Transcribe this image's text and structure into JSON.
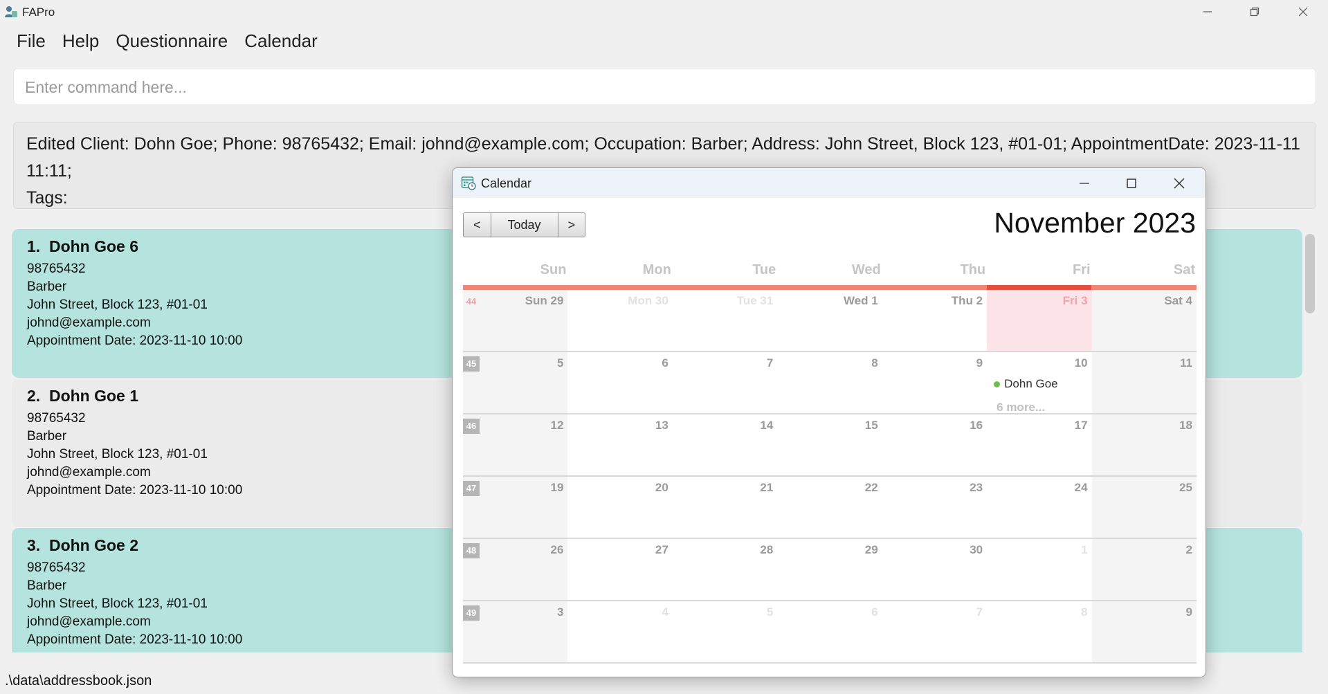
{
  "app": {
    "title": "FAPro"
  },
  "menu": [
    "File",
    "Help",
    "Questionnaire",
    "Calendar"
  ],
  "command": {
    "placeholder": "Enter command here..."
  },
  "result": {
    "line1": "Edited Client: Dohn Goe; Phone: 98765432; Email: johnd@example.com; Occupation: Barber; Address: John Street, Block 123, #01-01; AppointmentDate: 2023-11-11 11:11;",
    "line2": "Tags:"
  },
  "clients": [
    {
      "index": "1.",
      "name": "Dohn Goe 6",
      "phone": "98765432",
      "occupation": "Barber",
      "address": "John Street, Block 123, #01-01",
      "email": "johnd@example.com",
      "appointment": "Appointment Date: 2023-11-10 10:00"
    },
    {
      "index": "2.",
      "name": "Dohn Goe 1",
      "phone": "98765432",
      "occupation": "Barber",
      "address": "John Street, Block 123, #01-01",
      "email": "johnd@example.com",
      "appointment": "Appointment Date: 2023-11-10 10:00"
    },
    {
      "index": "3.",
      "name": "Dohn Goe 2",
      "phone": "98765432",
      "occupation": "Barber",
      "address": "John Street, Block 123, #01-01",
      "email": "johnd@example.com",
      "appointment": "Appointment Date: 2023-11-10 10:00"
    }
  ],
  "status": {
    "file_path": ".\\data\\addressbook.json"
  },
  "calendar": {
    "window_title": "Calendar",
    "prev_label": "<",
    "today_label": "Today",
    "next_label": ">",
    "month_title": "November 2023",
    "day_headers": [
      "Sun",
      "Mon",
      "Tue",
      "Wed",
      "Thu",
      "Fri",
      "Sat"
    ],
    "week_numbers": [
      "44",
      "45",
      "46",
      "47",
      "48",
      "49"
    ],
    "weeks": [
      [
        "Sun 29",
        "Mon 30",
        "Tue 31",
        "Wed 1",
        "Thu 2",
        "Fri 3",
        "Sat 4"
      ],
      [
        "5",
        "6",
        "7",
        "8",
        "9",
        "10",
        "11"
      ],
      [
        "12",
        "13",
        "14",
        "15",
        "16",
        "17",
        "18"
      ],
      [
        "19",
        "20",
        "21",
        "22",
        "23",
        "24",
        "25"
      ],
      [
        "26",
        "27",
        "28",
        "29",
        "30",
        "1",
        "2"
      ],
      [
        "3",
        "4",
        "5",
        "6",
        "7",
        "8",
        "9"
      ]
    ],
    "event": {
      "label": "Dohn Goe",
      "more": "6 more..."
    },
    "colors": {
      "today_bar": "#e54d3f",
      "header_bar": "#f08476",
      "event_dot": "#6dbf4b",
      "card_teal": "#b5e4de"
    }
  }
}
